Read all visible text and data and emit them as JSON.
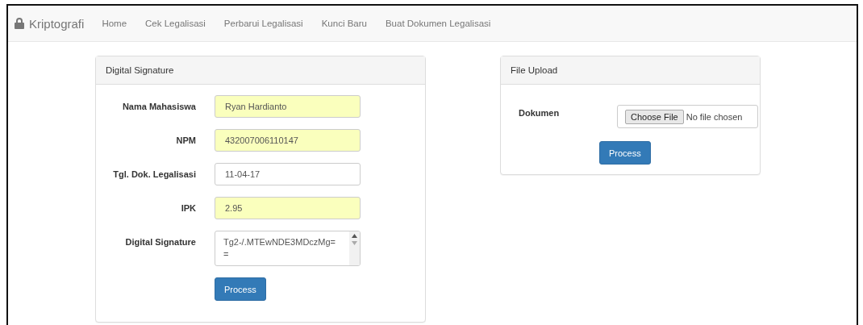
{
  "navbar": {
    "brand": "Kriptografi",
    "links": [
      {
        "label": "Home"
      },
      {
        "label": "Cek Legalisasi"
      },
      {
        "label": "Perbarui Legalisasi"
      },
      {
        "label": "Kunci Baru"
      },
      {
        "label": "Buat Dokumen Legalisasi"
      }
    ]
  },
  "signature_panel": {
    "title": "Digital Signature",
    "fields": [
      {
        "kind": "text",
        "label": "Nama Mahasiswa",
        "value": "Ryan Hardianto",
        "autofilled": true
      },
      {
        "kind": "text",
        "label": "NPM",
        "value": "432007006110147",
        "autofilled": true
      },
      {
        "kind": "text",
        "label": "Tgl. Dok. Legalisasi",
        "value": "11-04-17",
        "autofilled": false
      },
      {
        "kind": "text",
        "label": "IPK",
        "value": "2.95",
        "autofilled": true
      },
      {
        "kind": "textarea",
        "label": "Digital Signature",
        "lines": [
          "Tg2-/.MTEwNDE3MDczMg=",
          "="
        ],
        "autofilled": false
      }
    ],
    "button": "Process"
  },
  "upload_panel": {
    "title": "File Upload",
    "label": "Dokumen",
    "choose_button": "Choose File",
    "file_status": "No file chosen",
    "button": "Process"
  }
}
